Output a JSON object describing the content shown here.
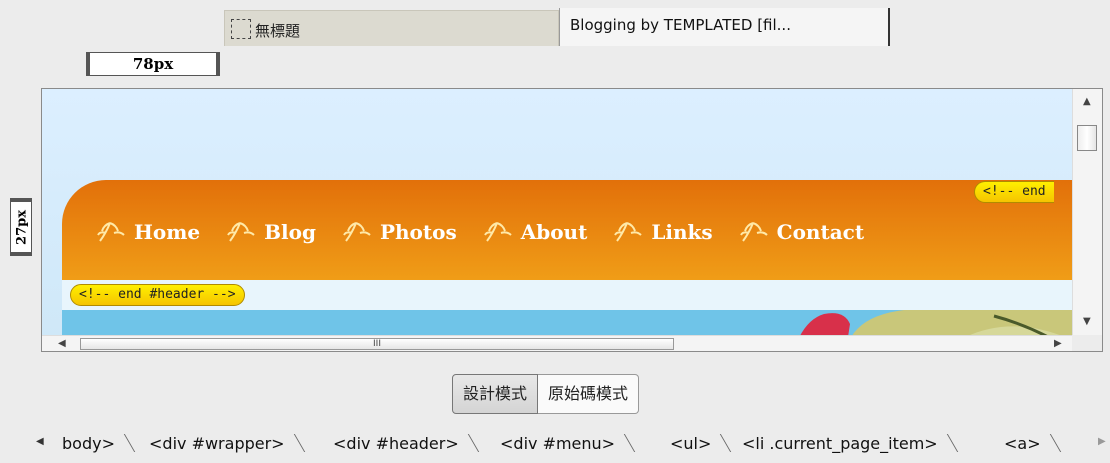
{
  "tabs": [
    {
      "label": "無標題",
      "active": false
    },
    {
      "label": "Blogging by TEMPLATED [fil...",
      "active": true
    }
  ],
  "rulers": {
    "width_label": "78px",
    "height_label": "27px"
  },
  "site": {
    "menu": [
      {
        "label": "Home"
      },
      {
        "label": "Blog"
      },
      {
        "label": "Photos"
      },
      {
        "label": "About"
      },
      {
        "label": "Links"
      },
      {
        "label": "Contact"
      }
    ],
    "header_end_comment": "<!-- end #header -->",
    "right_comment": "<!-- end",
    "colors": {
      "header_top": "#e2700a",
      "header_bottom": "#f09d17",
      "sky": "#dcefff",
      "hero": "#6fc4e8"
    }
  },
  "hscroll_grip": "III",
  "modes": {
    "design": "設計模式",
    "source": "原始碼模式"
  },
  "tag_selector": [
    "body>",
    "<div #wrapper>",
    "<div #header>",
    "<div #menu>",
    "<ul>",
    "<li .current_page_item>",
    "<a>"
  ]
}
